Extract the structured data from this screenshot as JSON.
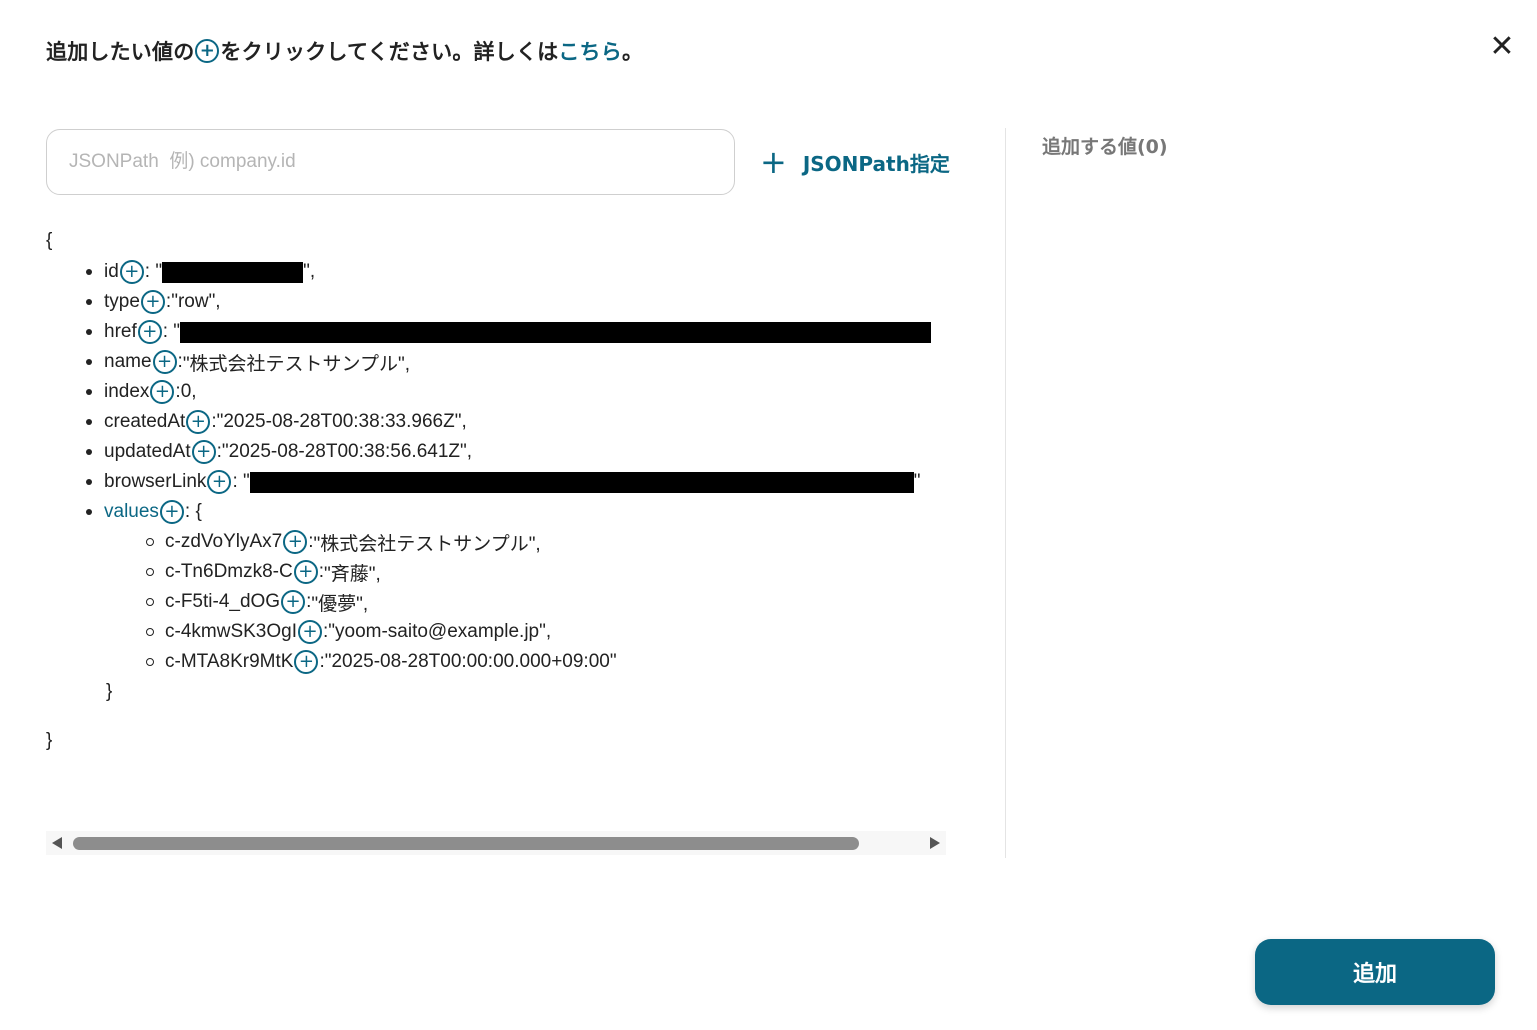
{
  "header": {
    "text_before_icon": "追加したい値の",
    "plus_glyph": "+",
    "text_after_icon": "をクリックしてください。詳しくは",
    "link_text": "こちら",
    "text_end": "。"
  },
  "close_glyph": "✕",
  "jsonpath": {
    "placeholder": "JSONPath  例) company.id",
    "value": "",
    "add_glyph": "+",
    "add_label": "JSONPath指定"
  },
  "selected_panel": {
    "title": "追加する値(0)"
  },
  "tree": {
    "open_brace": "{",
    "close_brace": "}",
    "items": [
      {
        "key": "id",
        "sep": ": \"",
        "value": "",
        "redacted": true,
        "suffix": "\","
      },
      {
        "key": "type",
        "sep": ": ",
        "value": "\"row\",",
        "redacted": false,
        "suffix": ""
      },
      {
        "key": "href",
        "sep": ": \"",
        "value": "",
        "redacted": true,
        "suffix": ""
      },
      {
        "key": "name",
        "sep": ": ",
        "value": "\"株式会社テストサンプル\",",
        "redacted": false,
        "suffix": ""
      },
      {
        "key": "index",
        "sep": ": ",
        "value": "0,",
        "redacted": false,
        "suffix": ""
      },
      {
        "key": "createdAt",
        "sep": ": ",
        "value": "\"2025-08-28T00:38:33.966Z\",",
        "redacted": false,
        "suffix": ""
      },
      {
        "key": "updatedAt",
        "sep": ": ",
        "value": "\"2025-08-28T00:38:56.641Z\",",
        "redacted": false,
        "suffix": ""
      },
      {
        "key": "browserLink",
        "sep": ": \"",
        "value": "",
        "redacted": true,
        "suffix": "\""
      }
    ],
    "values_key": "values",
    "values_sep": ": {",
    "values_close": "}",
    "values_items": [
      {
        "key": "c-zdVoYlyAx7",
        "sep": ": ",
        "value": "\"株式会社テストサンプル\","
      },
      {
        "key": "c-Tn6Dmzk8-C",
        "sep": ": ",
        "value": "\"斉藤\","
      },
      {
        "key": "c-F5ti-4_dOG",
        "sep": ": ",
        "value": "\"優夢\","
      },
      {
        "key": "c-4kmwSK3OgI",
        "sep": ": ",
        "value": "\"yoom-saito@example.jp\","
      },
      {
        "key": "c-MTA8Kr9MtK",
        "sep": ": ",
        "value": "\"2025-08-28T00:00:00.000+09:00\""
      }
    ]
  },
  "submit_label": "追加",
  "colors": {
    "accent": "#0b6784",
    "text": "#222222",
    "muted": "#777777"
  }
}
